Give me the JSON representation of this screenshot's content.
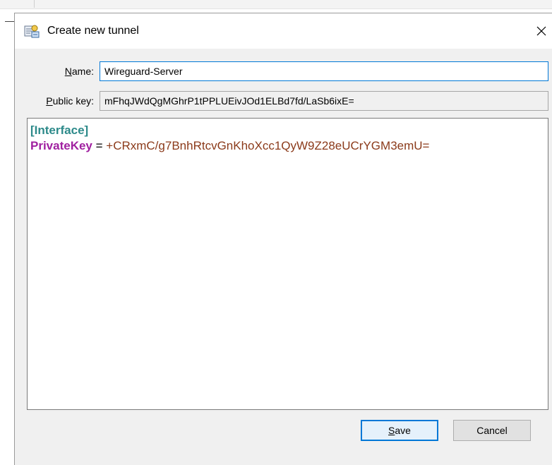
{
  "dialog": {
    "title": "Create new tunnel",
    "icon": "tunnel-config-icon",
    "close_label": "✕"
  },
  "form": {
    "name_label_mnemonic": "N",
    "name_label_rest": "ame:",
    "name_value": "Wireguard-Server",
    "pubkey_label_mnemonic": "P",
    "pubkey_label_rest": "ublic key:",
    "pubkey_value": "mFhqJWdQgMGhrP1tPPLUEivJOd1ELBd7fd/LaSb6ixE="
  },
  "editor": {
    "section": "[Interface]",
    "key": "PrivateKey",
    "equals": " = ",
    "value": "+CRxmC/g7BnhRtcvGnKhoXcc1QyW9Z28eUCrYGM3emU="
  },
  "buttons": {
    "save_mnemonic": "S",
    "save_rest": "ave",
    "cancel_label": "Cancel"
  },
  "colors": {
    "accent": "#0078d7",
    "section": "#2d8a8a",
    "key": "#a020a0",
    "value": "#8b3a1a"
  }
}
